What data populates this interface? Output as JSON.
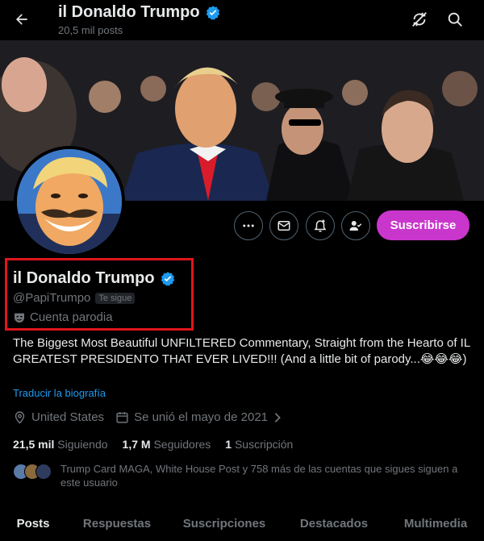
{
  "header": {
    "title": "il Donaldo Trumpo",
    "posts_count": "20,5 mil posts"
  },
  "profile": {
    "name": "il Donaldo Trumpo",
    "handle": "@PapiTrumpo",
    "follows_you_badge": "Te sigue",
    "parody_label": "Cuenta parodia",
    "bio": "The Biggest Most Beautiful UNFILTERED Commentary, Straight from the Hearto of IL GREATEST PRESIDENTO THAT EVER LIVED!!! (And a little bit of parody...😂😂😂)",
    "translate_link": "Traducir la biografía",
    "location": "United States",
    "joined": "Se unió el mayo de 2021",
    "following_count": "21,5 mil",
    "following_label": "Siguiendo",
    "followers_count": "1,7 M",
    "followers_label": "Seguidores",
    "subscriptions_count": "1",
    "subscriptions_label": "Suscripción",
    "followed_by_text": "Trump Card MAGA, White House Post y 758 más de las cuentas que sigues siguen a este usuario"
  },
  "actions": {
    "subscribe_label": "Suscribirse"
  },
  "tabs": [
    {
      "label": "Posts",
      "active": true
    },
    {
      "label": "Respuestas",
      "active": false
    },
    {
      "label": "Suscripciones",
      "active": false
    },
    {
      "label": "Destacados",
      "active": false
    },
    {
      "label": "Multimedia",
      "active": false
    }
  ],
  "colors": {
    "accent": "#1d9bf0",
    "subscribe": "#c936cc",
    "highlight_box": "#e0151b",
    "verified": "#1d9bf0"
  }
}
